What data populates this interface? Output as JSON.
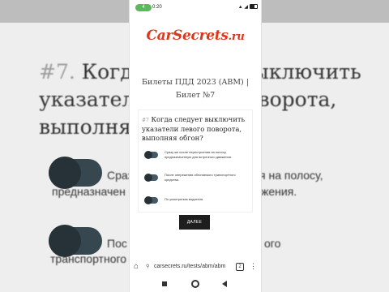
{
  "background": {
    "question_num": "#7.",
    "question_lines": [
      "Когда следует выключить",
      "указатели левого поворота,",
      "выполняя обгон?"
    ],
    "option_fragments": [
      [
        "Сраз",
        "я на полосу,"
      ],
      [
        "предназначен",
        "жения."
      ],
      [
        "Пос",
        "ого"
      ],
      [
        "транспортного",
        ""
      ]
    ]
  },
  "status": {
    "pill": "4",
    "time": "0:20",
    "right": "▲ ◢"
  },
  "site": {
    "logo_main": "CarSecrets",
    "logo_suffix": ".ru"
  },
  "page_title": "Билеты ПДД 2023 (ABM) | Билет №7",
  "question": {
    "number": "#7",
    "text": "Когда следует выключить указатели левого поворота, выполняя обгон?"
  },
  "options": [
    "Сразу же после перестроения на полосу, предназначенную для встречного движения.",
    "После опережения обгоняемого транспортного средства.",
    "По усмотрению водителя."
  ],
  "next_button": "ДАЛЕЕ",
  "browser": {
    "url": "carsecrets.ru/tests/abm/abm",
    "tabs_count": "2",
    "home_icon": "⌂",
    "lock_icon": "⚲",
    "menu_icon": "⋮"
  },
  "colors": {
    "logo": "#d9381e",
    "status_pill": "#5cb85c",
    "button": "#1e1e1e",
    "toggle": "#455a64"
  }
}
